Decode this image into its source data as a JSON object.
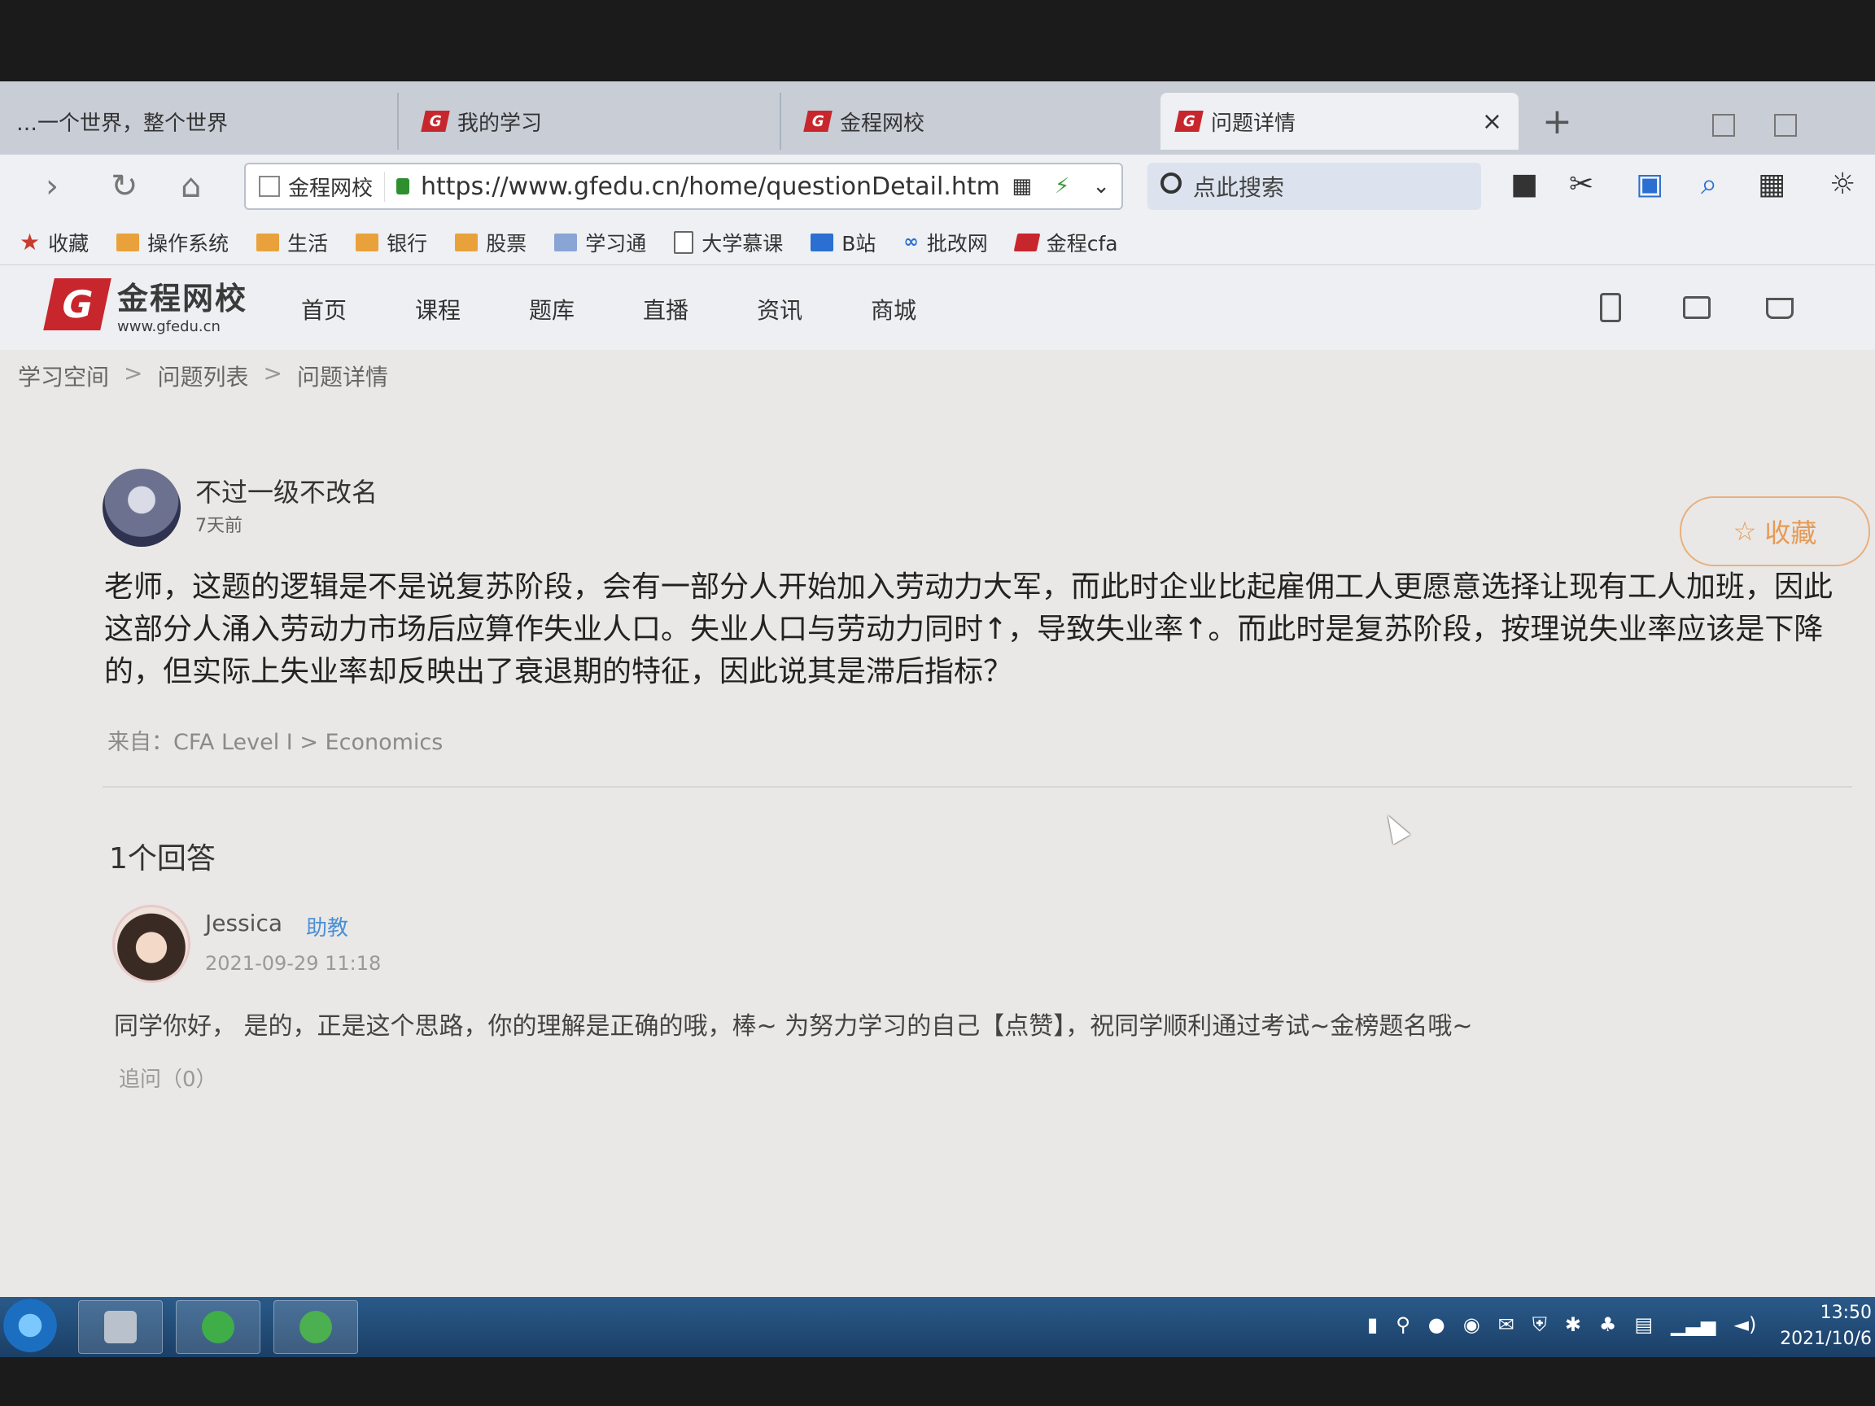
{
  "browser": {
    "tabs": [
      {
        "label": "…一个世界，整个世界"
      },
      {
        "label": "我的学习"
      },
      {
        "label": "金程网校"
      },
      {
        "label": "问题详情"
      }
    ],
    "close_glyph": "×",
    "new_tab_glyph": "+",
    "address": {
      "site_name": "金程网校",
      "url": "https://www.gfedu.cn/home/questionDetail.html?i"
    },
    "search_placeholder": "点此搜索",
    "bookmarks": [
      {
        "label": "收藏"
      },
      {
        "label": "操作系统"
      },
      {
        "label": "生活"
      },
      {
        "label": "银行"
      },
      {
        "label": "股票"
      },
      {
        "label": "学习通"
      },
      {
        "label": "大学慕课"
      },
      {
        "label": "B站"
      },
      {
        "label": "批改网"
      },
      {
        "label": "金程cfa"
      }
    ]
  },
  "site": {
    "brand_cn": "金程网校",
    "brand_en": "www.gfedu.cn",
    "brand_mark": "G",
    "nav": [
      "首页",
      "课程",
      "题库",
      "直播",
      "资讯",
      "商城"
    ]
  },
  "breadcrumb": [
    "学习空间",
    "问题列表",
    "问题详情"
  ],
  "breadcrumb_sep": ">",
  "question": {
    "user": "不过一级不改名",
    "time": "7天前",
    "favorite_label": "收藏",
    "text": "老师，这题的逻辑是不是说复苏阶段，会有一部分人开始加入劳动力大军，而此时企业比起雇佣工人更愿意选择让现有工人加班，因此这部分人涌入劳动力市场后应算作失业人口。失业人口与劳动力同时↑，导致失业率↑。而此时是复苏阶段，按理说失业率应该是下降的，但实际上失业率却反映出了衰退期的特征，因此说其是滞后指标？",
    "source": "来自：CFA Level I > Economics"
  },
  "answers": {
    "count_label": "1个回答",
    "items": [
      {
        "user": "Jessica",
        "role": "助教",
        "time": "2021-09-29 11:18",
        "text": "同学你好， 是的，正是这个思路，你的理解是正确的哦，棒~ 为努力学习的自己【点赞】，祝同学顺利通过考试~金榜题名哦~",
        "followup": "追问（0）"
      }
    ]
  },
  "taskbar": {
    "time": "13:50",
    "date": "2021/10/6"
  },
  "colors": {
    "brand_red": "#c8262d",
    "assistant_blue": "#4a8fd6",
    "favorite_orange": "#e69a55"
  }
}
